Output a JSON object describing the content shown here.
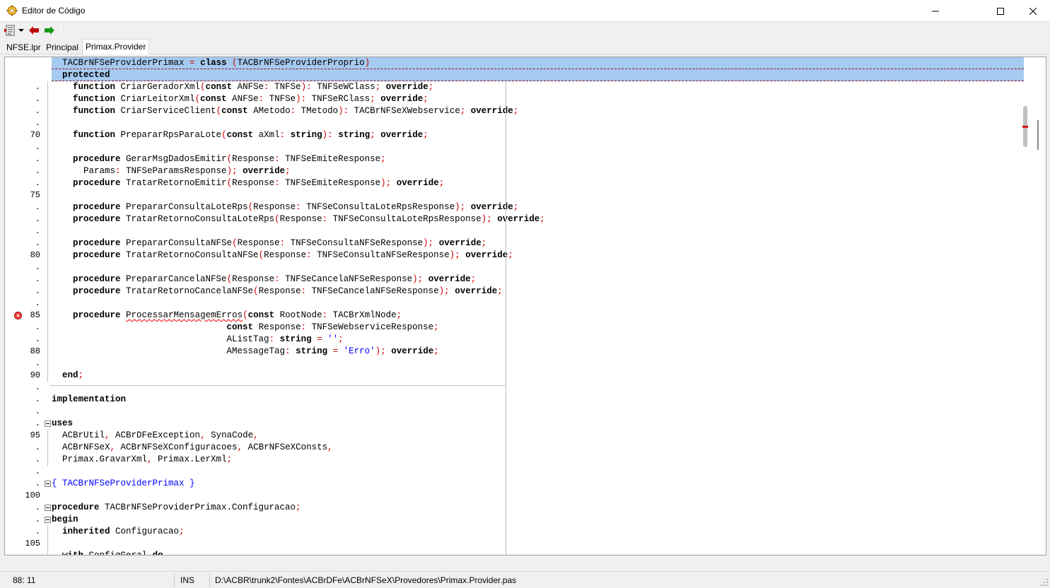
{
  "window": {
    "title": "Editor de Código",
    "minimize_label": "minimize",
    "maximize_label": "maximize",
    "close_label": "close"
  },
  "toolbar": {
    "items": [
      {
        "name": "source-menu-icon"
      },
      {
        "name": "dropdown-arrow-icon"
      },
      {
        "name": "back-arrow-icon"
      },
      {
        "name": "forward-arrow-icon"
      }
    ]
  },
  "tabs": [
    {
      "label": "NFSE.lpr",
      "active": false
    },
    {
      "label": "Principal",
      "active": false
    },
    {
      "label": "Primax.Provider",
      "active": true
    }
  ],
  "editor": {
    "gutter": [
      "",
      "",
      ".",
      ".",
      ".",
      ".",
      "70",
      ".",
      ".",
      ".",
      ".",
      "75",
      ".",
      ".",
      ".",
      ".",
      "80",
      ".",
      ".",
      ".",
      ".",
      "85",
      ".",
      ".",
      "88",
      ".",
      "90",
      ".",
      ".",
      ".",
      ".",
      "95",
      ".",
      ".",
      ".",
      ".",
      "100",
      ".",
      ".",
      ".",
      "105"
    ],
    "breakpoint_line": "85",
    "lines": [
      {
        "t": "  TACBrNFSeProviderPrimax = class (TACBrNFSeProviderProprio)",
        "hl": true
      },
      {
        "t": "  protected",
        "hl": true
      },
      {
        "t": "    function CriarGeradorXml(const ANFSe: TNFSe): TNFSeWClass; override;"
      },
      {
        "t": "    function CriarLeitorXml(const ANFSe: TNFSe): TNFSeRClass; override;"
      },
      {
        "t": "    function CriarServiceClient(const AMetodo: TMetodo): TACBrNFSeXWebservice; override;"
      },
      {
        "t": ""
      },
      {
        "t": "    function PrepararRpsParaLote(const aXml: string): string; override;"
      },
      {
        "t": ""
      },
      {
        "t": "    procedure GerarMsgDadosEmitir(Response: TNFSeEmiteResponse;"
      },
      {
        "t": "      Params: TNFSeParamsResponse); override;"
      },
      {
        "t": "    procedure TratarRetornoEmitir(Response: TNFSeEmiteResponse); override;"
      },
      {
        "t": ""
      },
      {
        "t": "    procedure PrepararConsultaLoteRps(Response: TNFSeConsultaLoteRpsResponse); override;"
      },
      {
        "t": "    procedure TratarRetornoConsultaLoteRps(Response: TNFSeConsultaLoteRpsResponse); override;"
      },
      {
        "t": ""
      },
      {
        "t": "    procedure PrepararConsultaNFSe(Response: TNFSeConsultaNFSeResponse); override;"
      },
      {
        "t": "    procedure TratarRetornoConsultaNFSe(Response: TNFSeConsultaNFSeResponse); override;"
      },
      {
        "t": ""
      },
      {
        "t": "    procedure PrepararCancelaNFSe(Response: TNFSeCancelaNFSeResponse); override;"
      },
      {
        "t": "    procedure TratarRetornoCancelaNFSe(Response: TNFSeCancelaNFSeResponse); override;"
      },
      {
        "t": ""
      },
      {
        "t": "    procedure ProcessarMensagemErros(const RootNode: TACBrXmlNode;"
      },
      {
        "t": "                                 const Response: TNFSeWebserviceResponse;"
      },
      {
        "t": "                                 AListTag: string = '';"
      },
      {
        "t": "                                 AMessageTag: string = 'Erro'); override;"
      },
      {
        "t": ""
      },
      {
        "t": "  end;"
      },
      {
        "t": ""
      },
      {
        "t": "implementation"
      },
      {
        "t": ""
      },
      {
        "t": "uses"
      },
      {
        "t": "  ACBrUtil, ACBrDFeException, SynaCode,"
      },
      {
        "t": "  ACBrNFSeX, ACBrNFSeXConfiguracoes, ACBrNFSeXConsts,"
      },
      {
        "t": "  Primax.GravarXml, Primax.LerXml;"
      },
      {
        "t": ""
      },
      {
        "t": "{ TACBrNFSeProviderPrimax }"
      },
      {
        "t": ""
      },
      {
        "t": "procedure TACBrNFSeProviderPrimax.Configuracao;"
      },
      {
        "t": "begin"
      },
      {
        "t": "  inherited Configuracao;"
      },
      {
        "t": ""
      },
      {
        "t": "  with ConfigGeral do"
      }
    ]
  },
  "statusbar": {
    "position": "88: 11",
    "mode": "INS",
    "path": "D:\\ACBR\\trunk2\\Fontes\\ACBrDFe\\ACBrNFSeX\\Provedores\\Primax.Provider.pas"
  }
}
